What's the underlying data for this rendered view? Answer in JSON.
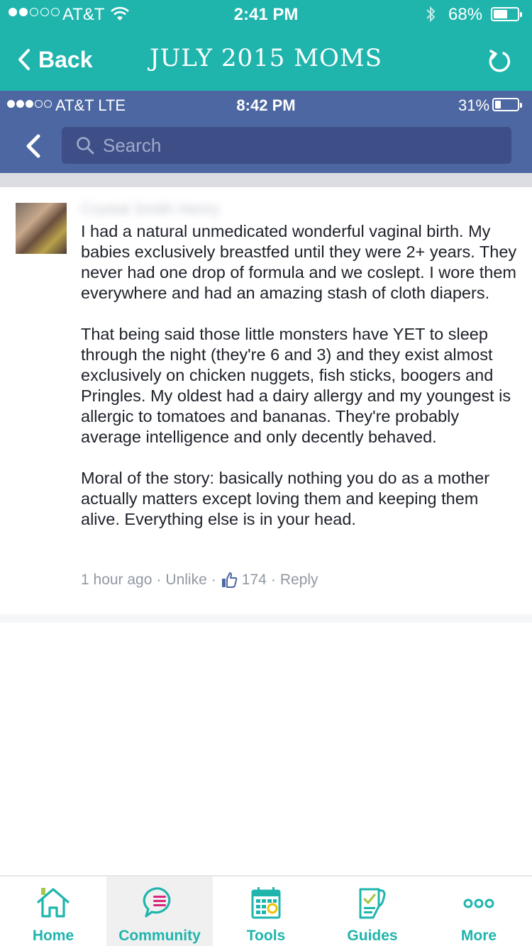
{
  "status_bar": {
    "carrier": "AT&T",
    "time": "2:41 PM",
    "battery_percent": "68%",
    "battery_level": 0.68
  },
  "nav": {
    "back_label": "Back",
    "title": "JULY 2015 MOMS"
  },
  "embedded": {
    "status_bar": {
      "carrier": "AT&T  LTE",
      "time": "8:42 PM",
      "battery_percent": "31%",
      "battery_level": 0.31
    },
    "search": {
      "placeholder": "Search"
    },
    "comment": {
      "author": "Crystal Smith Henry",
      "paragraphs": [
        "I had a natural unmedicated wonderful vaginal birth. My babies exclusively breastfed until they were 2+ years. They never had one drop of formula and we coslept. I wore them everywhere and had an amazing stash of cloth diapers.",
        "That being said those little monsters have YET to sleep through the night (they're 6 and 3) and they exist almost exclusively on chicken nuggets, fish sticks, boogers and Pringles. My oldest had a dairy allergy and my youngest is allergic to tomatoes and bananas. They're probably average intelligence and only decently behaved.",
        "Moral of the story: basically nothing you do as a mother actually matters except loving them and keeping them alive. Everything else is in your head."
      ],
      "time_ago": "1 hour ago",
      "unlike_label": "Unlike",
      "like_count": "174",
      "reply_label": "Reply",
      "separator": "·"
    }
  },
  "tabs": [
    {
      "label": "Home",
      "icon": "home-icon"
    },
    {
      "label": "Community",
      "icon": "chat-bubble-icon"
    },
    {
      "label": "Tools",
      "icon": "calendar-icon"
    },
    {
      "label": "Guides",
      "icon": "clipboard-icon"
    },
    {
      "label": "More",
      "icon": "more-dots-icon"
    }
  ],
  "colors": {
    "brand_teal": "#1fb5ad",
    "facebook_blue": "#4c67a1",
    "accent_pink": "#d6267a",
    "accent_yellow": "#f2c200"
  }
}
